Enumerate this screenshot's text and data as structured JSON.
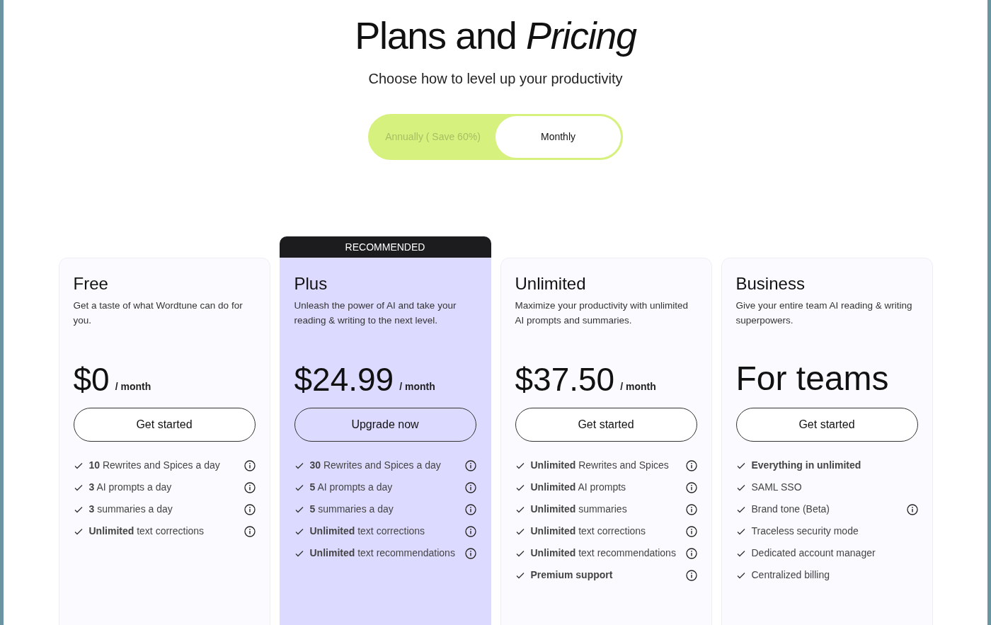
{
  "title": "Plans and *Pricing*",
  "subtitle": "Choose how to level up your productivity",
  "billing_toggle": [
    {
      "label": "Annually ( Save 60%)",
      "selected": false
    },
    {
      "label": "Monthly",
      "selected": true
    }
  ],
  "plans": [
    {
      "name": "Free",
      "description": "Get a taste of what Wordtune can do for you.",
      "price": "$0",
      "period": "/ month",
      "button": "Get started",
      "highlighted": false,
      "features": [
        {
          "text": "**10** Rewrites and Spices a day",
          "info": true
        },
        {
          "text": "**3** AI prompts a day",
          "info": true
        },
        {
          "text": "**3** summaries a day",
          "info": true
        },
        {
          "text": "**Unlimited** text corrections",
          "info": true
        }
      ]
    },
    {
      "name": "Plus",
      "badge": "RECOMMENDED",
      "description": "Unleash the power of AI and take your reading & writing to the next level.",
      "price": "$24.99",
      "period": "/ month",
      "button": "Upgrade now",
      "highlighted": true,
      "features": [
        {
          "text": "**30** Rewrites and Spices a day",
          "info": true
        },
        {
          "text": "**5** AI prompts a day",
          "info": true
        },
        {
          "text": "**5** summaries a day",
          "info": true
        },
        {
          "text": "**Unlimited** text corrections",
          "info": true
        },
        {
          "text": "**Unlimited** text recommendations",
          "info": true
        }
      ]
    },
    {
      "name": "Unlimited",
      "description": "Maximize your productivity with unlimited AI prompts and summaries.",
      "price": "$37.50",
      "period": "/ month",
      "button": "Get started",
      "highlighted": false,
      "features": [
        {
          "text": "**Unlimited** Rewrites and Spices",
          "info": true
        },
        {
          "text": "**Unlimited** AI prompts",
          "info": true
        },
        {
          "text": "**Unlimited** summaries",
          "info": true
        },
        {
          "text": "**Unlimited** text corrections",
          "info": true
        },
        {
          "text": "**Unlimited** text recommendations",
          "info": true
        },
        {
          "text": "**Premium support**",
          "info": true
        }
      ]
    },
    {
      "name": "Business",
      "description": "Give your entire team AI reading & writing superpowers.",
      "price": "For teams",
      "button": "Get started",
      "highlighted": false,
      "features": [
        {
          "text": "**Everything in unlimited**",
          "info": false
        },
        {
          "text": "SAML SSO",
          "info": false
        },
        {
          "text": "Brand tone (Beta)",
          "info": true
        },
        {
          "text": "Traceless security mode",
          "info": false
        },
        {
          "text": "Dedicated account manager",
          "info": false
        },
        {
          "text": "Centralized billing",
          "info": false
        }
      ]
    }
  ]
}
